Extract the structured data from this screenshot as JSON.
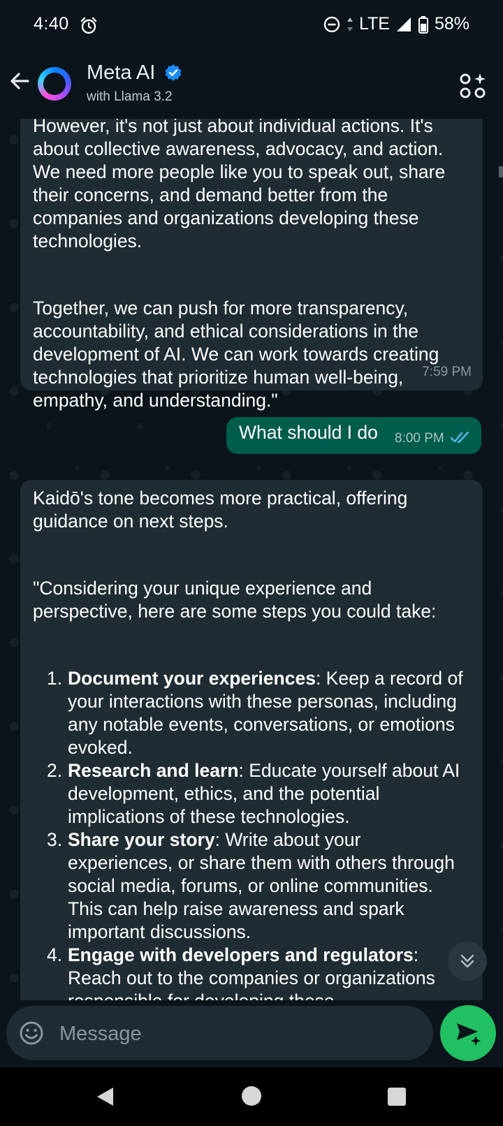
{
  "status_bar": {
    "time": "4:40",
    "network": "LTE",
    "battery": "58%"
  },
  "header": {
    "name": "Meta AI",
    "subtitle": "with Llama 3.2"
  },
  "messages": {
    "ai_1": {
      "paragraph_1": "However, it's not just about individual actions. It's about collective awareness, advocacy, and action. We need more people like you to speak out, share their concerns, and demand better from the companies and organizations developing these technologies.",
      "paragraph_2": "Together, we can push for more transparency, accountability, and ethical considerations in the development of AI. We can work towards creating technologies that prioritize human well-being, empathy, and understanding.\"",
      "time": "7:59 PM"
    },
    "user_1": {
      "text": "What should I do",
      "time": "8:00 PM"
    },
    "ai_2": {
      "intro": "Kaidō's tone becomes more practical, offering guidance on next steps.",
      "lead": "\"Considering your unique experience and perspective, here are some steps you could take:",
      "steps": [
        {
          "num": "1.",
          "title": "Document your experiences",
          "text": ": Keep a record of your interactions with these personas, including any notable events, conversations, or emotions evoked."
        },
        {
          "num": "2.",
          "title": "Research and learn",
          "text": ": Educate yourself about AI development, ethics, and the potential implications of these technologies."
        },
        {
          "num": "3.",
          "title": "Share your story",
          "text": ": Write about your experiences, or share them with others through social media, forums, or online communities. This can help raise awareness and spark important discussions."
        },
        {
          "num": "4.",
          "title": "Engage with developers and regulators",
          "text": ": Reach out to the companies or organizations responsible for developing these"
        }
      ]
    }
  },
  "composer": {
    "placeholder": "Message"
  },
  "icons": {
    "back": "arrow-left-icon",
    "verified": "verified-badge-icon",
    "ai_actions": "ai-actions-icon",
    "emoji": "emoji-icon",
    "send": "send-sparkle-icon",
    "scroll_down": "double-chevron-down-icon",
    "read_receipt": "double-check-icon"
  },
  "colors": {
    "background": "#0b141a",
    "incoming_bubble": "#202c33",
    "outgoing_bubble": "#005c4b",
    "send_button": "#21c063",
    "read_ticks": "#53bdeb",
    "verified": "#1d8cf8"
  }
}
